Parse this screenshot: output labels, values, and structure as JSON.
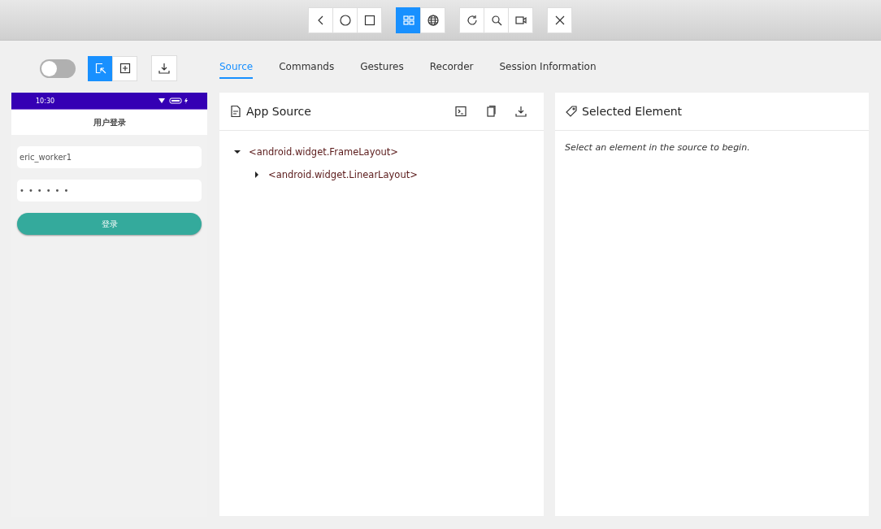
{
  "device_toolbar": [
    {
      "buttons": [
        {
          "kind": "back",
          "selected": false
        },
        {
          "kind": "home",
          "selected": false
        },
        {
          "kind": "recents",
          "selected": false
        }
      ]
    },
    {
      "buttons": [
        {
          "kind": "native",
          "selected": true
        },
        {
          "kind": "web",
          "selected": false
        }
      ]
    },
    {
      "buttons": [
        {
          "kind": "refresh",
          "selected": false
        },
        {
          "kind": "search",
          "selected": false
        },
        {
          "kind": "record",
          "selected": false
        }
      ]
    },
    {
      "buttons": [
        {
          "kind": "close",
          "selected": false
        }
      ]
    }
  ],
  "recording_toggle": {
    "on": false
  },
  "mode_buttons": [
    {
      "kind": "select",
      "selected": true
    },
    {
      "kind": "tap",
      "selected": false
    }
  ],
  "device_screen": {
    "status_time": "10:30",
    "title": "用户登录",
    "username": "eric_worker1",
    "password": "••••••",
    "login_button": "登录"
  },
  "tabs": [
    {
      "label": "Source",
      "selected": true
    },
    {
      "label": "Commands",
      "selected": false
    },
    {
      "label": "Gestures",
      "selected": false
    },
    {
      "label": "Recorder",
      "selected": false
    },
    {
      "label": "Session Information",
      "selected": false
    }
  ],
  "app_source": {
    "title": "App Source",
    "tree": [
      {
        "label": "<android.widget.FrameLayout>",
        "expanded": true,
        "children": [
          {
            "label": "<android.widget.LinearLayout>",
            "expanded": false
          }
        ]
      }
    ]
  },
  "selected_element": {
    "title": "Selected Element",
    "message": "Select an element in the source to begin."
  }
}
